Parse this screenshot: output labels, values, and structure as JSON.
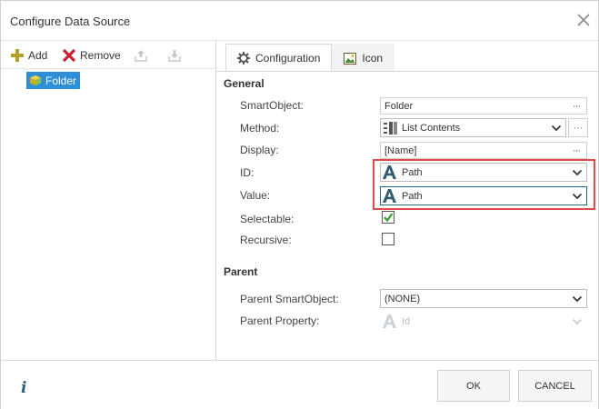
{
  "dialog": {
    "title": "Configure Data Source"
  },
  "left_toolbar": {
    "add_label": "Add",
    "remove_label": "Remove"
  },
  "tree": {
    "items": [
      {
        "label": "Folder",
        "selected": true
      }
    ]
  },
  "tabs": [
    {
      "label": "Configuration",
      "active": true
    },
    {
      "label": "Icon",
      "active": false
    }
  ],
  "general": {
    "heading": "General",
    "smartobject": {
      "label": "SmartObject:",
      "value": "Folder"
    },
    "method": {
      "label": "Method:",
      "value": "List Contents"
    },
    "display": {
      "label": "Display:",
      "value": "[Name]"
    },
    "id": {
      "label": "ID:",
      "value": "Path"
    },
    "value": {
      "label": "Value:",
      "value": "Path"
    },
    "selectable": {
      "label": "Selectable:",
      "checked": true
    },
    "recursive": {
      "label": "Recursive:",
      "checked": false
    }
  },
  "parent": {
    "heading": "Parent",
    "smartobject": {
      "label": "Parent SmartObject:",
      "value": "(NONE)"
    },
    "property": {
      "label": "Parent Property:",
      "value": "Id"
    }
  },
  "footer": {
    "ok_label": "OK",
    "cancel_label": "CANCEL"
  },
  "colors": {
    "accent": "#2d8fd8",
    "highlight": "#e04a4a",
    "check": "#3a9a3a",
    "info": "#2a5f88"
  }
}
